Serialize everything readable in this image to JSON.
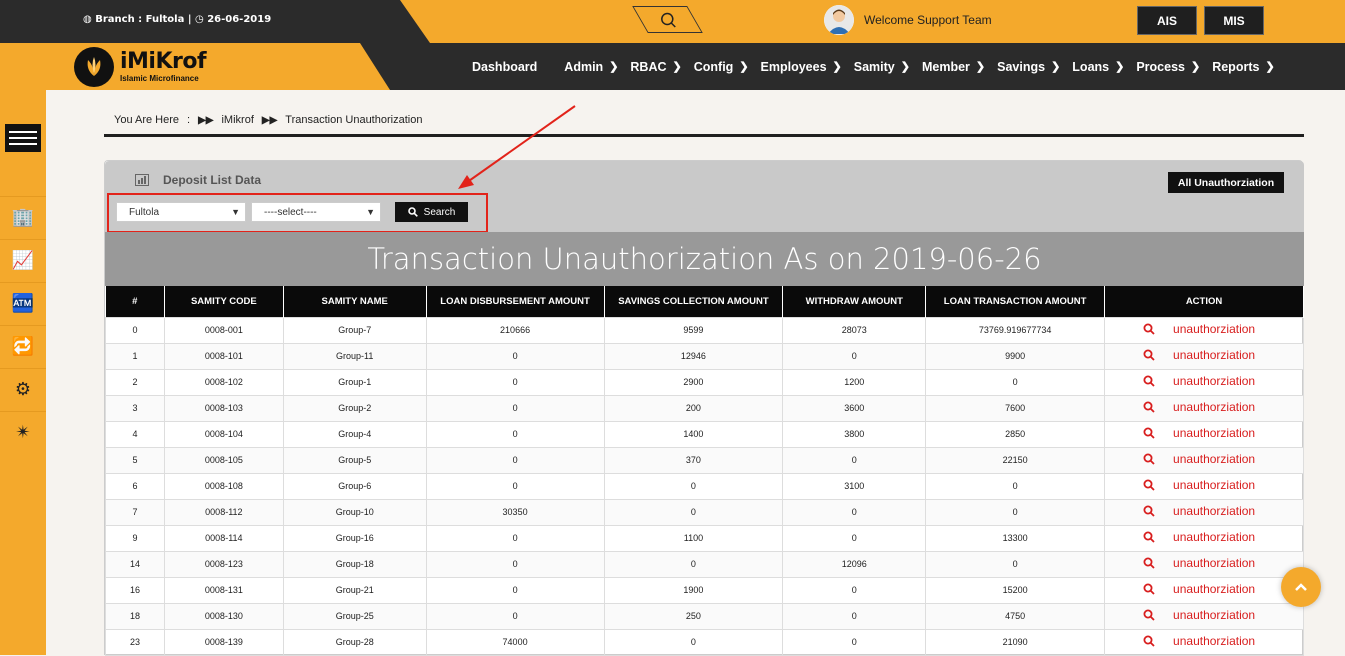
{
  "topbar": {
    "branch_text": "Branch : Fultola |",
    "date_text": "26-06-2019",
    "welcome": "Welcome Support Team",
    "btn_ais": "AIS",
    "btn_mis": "MIS"
  },
  "logo": {
    "name": "iMiKrof",
    "tagline": "Islamic Microfinance"
  },
  "nav": [
    {
      "label": "Dashboard",
      "chev": ""
    },
    {
      "label": "Admin",
      "chev": "❯"
    },
    {
      "label": "RBAC",
      "chev": "❯"
    },
    {
      "label": "Config",
      "chev": "❯"
    },
    {
      "label": "Employees",
      "chev": "❯"
    },
    {
      "label": "Samity",
      "chev": "❯"
    },
    {
      "label": "Member",
      "chev": "❯"
    },
    {
      "label": "Savings",
      "chev": "❯"
    },
    {
      "label": "Loans",
      "chev": "❯"
    },
    {
      "label": "Process",
      "chev": "❯"
    },
    {
      "label": "Reports",
      "chev": "❯"
    }
  ],
  "breadcrumb": {
    "prefix": "You Are Here",
    "sep": ":",
    "home": "iMikrof",
    "current": "Transaction Unauthorization"
  },
  "panel": {
    "title": "Deposit List Data",
    "all_btn": "All Unauthorziation",
    "branch_select": "Fultola",
    "second_select": "----select----",
    "search_btn": "Search",
    "report_title": "Transaction Unauthorization As on 2019-06-26"
  },
  "table": {
    "headers": [
      "#",
      "SAMITY CODE",
      "SAMITY NAME",
      "LOAN DISBURSEMENT AMOUNT",
      "SAVINGS COLLECTION AMOUNT",
      "WITHDRAW AMOUNT",
      "LOAN TRANSACTION AMOUNT",
      "ACTION"
    ],
    "action_label": "unauthorziation",
    "rows": [
      [
        "0",
        "0008-001",
        "Group-7",
        "210666",
        "9599",
        "28073",
        "73769.919677734"
      ],
      [
        "1",
        "0008-101",
        "Group-11",
        "0",
        "12946",
        "0",
        "9900"
      ],
      [
        "2",
        "0008-102",
        "Group-1",
        "0",
        "2900",
        "1200",
        "0"
      ],
      [
        "3",
        "0008-103",
        "Group-2",
        "0",
        "200",
        "3600",
        "7600"
      ],
      [
        "4",
        "0008-104",
        "Group-4",
        "0",
        "1400",
        "3800",
        "2850"
      ],
      [
        "5",
        "0008-105",
        "Group-5",
        "0",
        "370",
        "0",
        "22150"
      ],
      [
        "6",
        "0008-108",
        "Group-6",
        "0",
        "0",
        "3100",
        "0"
      ],
      [
        "7",
        "0008-112",
        "Group-10",
        "30350",
        "0",
        "0",
        "0"
      ],
      [
        "9",
        "0008-114",
        "Group-16",
        "0",
        "1100",
        "0",
        "13300"
      ],
      [
        "14",
        "0008-123",
        "Group-18",
        "0",
        "0",
        "12096",
        "0"
      ],
      [
        "16",
        "0008-131",
        "Group-21",
        "0",
        "1900",
        "0",
        "15200"
      ],
      [
        "18",
        "0008-130",
        "Group-25",
        "0",
        "250",
        "0",
        "4750"
      ],
      [
        "23",
        "0008-139",
        "Group-28",
        "74000",
        "0",
        "0",
        "21090"
      ]
    ]
  },
  "colors": {
    "accent": "#f4a92c",
    "dark": "#2b2b2b",
    "action_red": "#d81e1e"
  }
}
